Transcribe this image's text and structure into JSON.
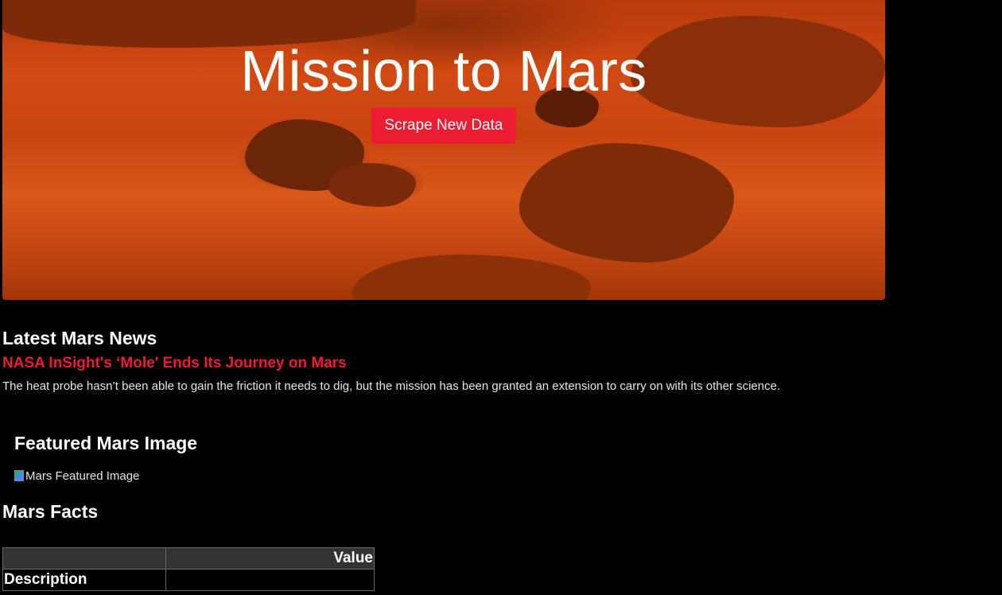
{
  "hero": {
    "title": "Mission to Mars",
    "button_label": "Scrape New Data",
    "accent_color": "#ec1c33"
  },
  "news": {
    "heading": "Latest Mars News",
    "title": "NASA InSight's ‘Mole' Ends Its Journey on Mars",
    "teaser": "The heat probe hasn’t been able to gain the friction it needs to dig, but the mission has been granted an extension to carry on with its other science."
  },
  "featured": {
    "heading": "Featured Mars Image",
    "image_alt": "Mars Featured Image",
    "icon": "broken-image-icon"
  },
  "facts": {
    "heading": "Mars Facts",
    "columns": [
      "",
      "Value"
    ],
    "rows": [
      [
        "Description",
        ""
      ]
    ]
  }
}
